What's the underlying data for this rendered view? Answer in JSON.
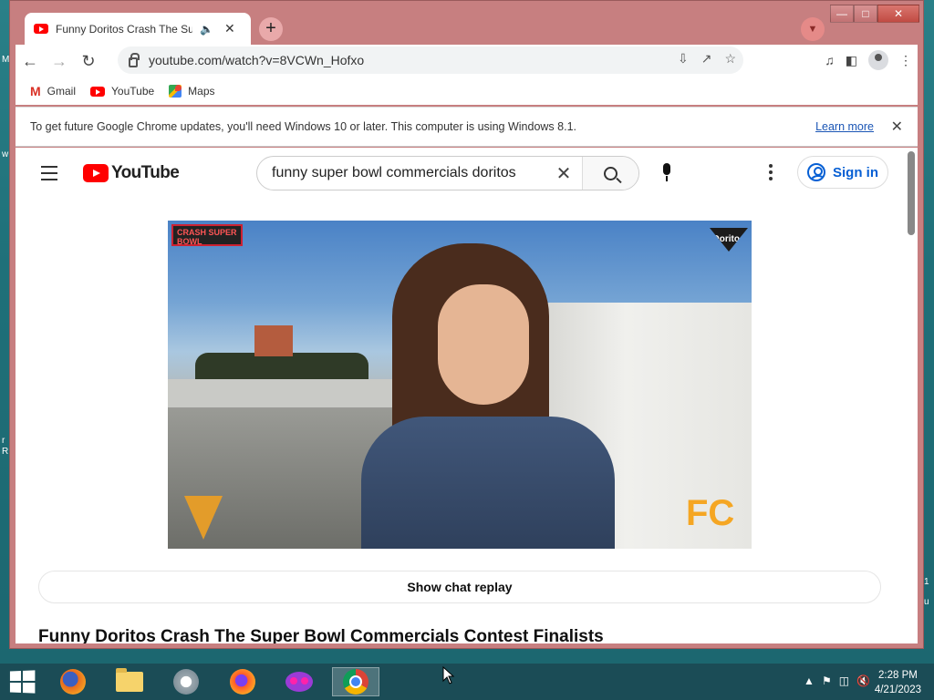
{
  "browser": {
    "tab_title": "Funny Doritos Crash The Super Bowl Commercials Contest Finalists",
    "url": "youtube.com/watch?v=8VCWn_Hofxo",
    "bookmarks": [
      {
        "label": "Gmail",
        "icon": "gmail-icon"
      },
      {
        "label": "YouTube",
        "icon": "youtube-icon"
      },
      {
        "label": "Maps",
        "icon": "maps-icon"
      }
    ],
    "infobar_text": "To get future Google Chrome updates, you'll need Windows 10 or later. This computer is using Windows 8.1.",
    "infobar_link": "Learn more"
  },
  "youtube": {
    "logo_text": "YouTube",
    "search_value": "funny super bowl commercials doritos",
    "sign_in_label": "Sign in",
    "video_overlay_tl": "CRASH SUPER BOWL",
    "video_overlay_tr": "Doritos",
    "video_overlay_br": "FC",
    "chat_replay_label": "Show chat replay",
    "video_title": "Funny Doritos Crash The Super Bowl Commercials Contest Finalists"
  },
  "taskbar": {
    "time": "2:28 PM",
    "date": "4/21/2023",
    "apps": [
      "firefox-icon",
      "file-explorer-icon",
      "thunderbird-icon",
      "firefox-nightly-icon",
      "privacy-mask-icon",
      "chrome-icon"
    ]
  },
  "colors": {
    "window_frame": "#c77f80",
    "youtube_red": "#ff0000",
    "link_blue": "#065fd4",
    "taskbar": "#1b4c56"
  }
}
